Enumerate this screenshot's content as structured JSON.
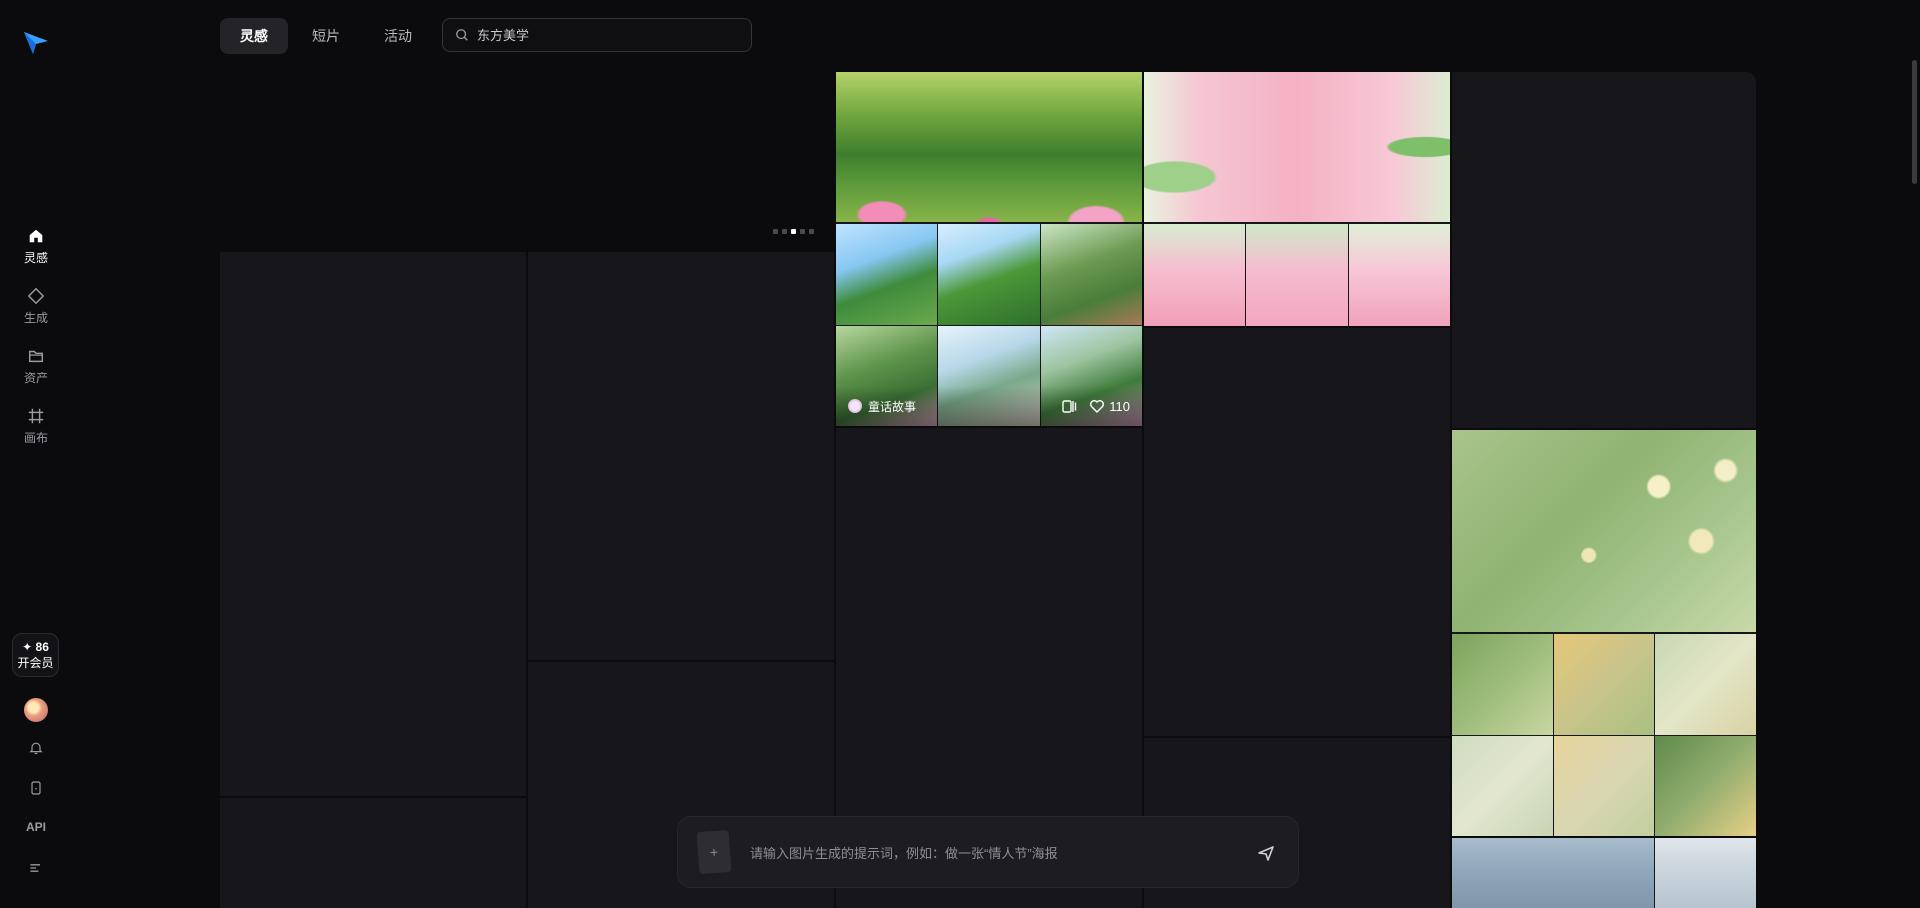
{
  "sidebar": {
    "logo": "paper-plane-logo",
    "items": [
      {
        "label": "灵感",
        "icon": "home-icon",
        "active": true
      },
      {
        "label": "生成",
        "icon": "diamond-icon",
        "active": false
      },
      {
        "label": "资产",
        "icon": "folder-icon",
        "active": false
      },
      {
        "label": "画布",
        "icon": "canvas-icon",
        "active": false
      }
    ],
    "vip": {
      "points": "✦ 86",
      "label": "开会员"
    },
    "bottom_icons": [
      "avatar",
      "bell-icon",
      "device-icon",
      "menu-icon"
    ],
    "api_label": "API"
  },
  "header": {
    "tabs": [
      {
        "label": "灵感",
        "active": true
      },
      {
        "label": "短片",
        "active": false
      },
      {
        "label": "活动",
        "active": false
      }
    ],
    "search": {
      "placeholder": "东方美学",
      "icon": "search-icon"
    }
  },
  "carousel": {
    "count": 5,
    "active_index": 2
  },
  "feed": {
    "featured_card": {
      "author": "童话故事",
      "likes": "110",
      "icons": [
        "copy-icon",
        "heart-icon"
      ]
    }
  },
  "prompt": {
    "placeholder": "请输入图片生成的提示词，例如：做一张“情人节”海报",
    "add_icon": "plus-icon",
    "send_icon": "send-icon"
  },
  "colors": {
    "background": "#0b0b0d",
    "card": "#17171b",
    "tab_active": "#232328",
    "accent_logo": "#3aa0ff"
  }
}
